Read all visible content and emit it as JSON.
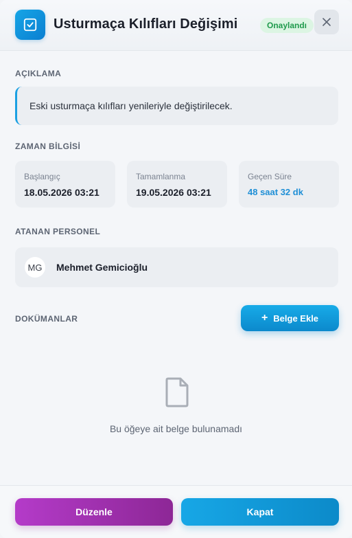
{
  "header": {
    "title": "Usturmaça Kılıfları Değişimi",
    "status": "Onaylandı",
    "app_icon": "checkbox-edit-icon",
    "close_icon": "close-icon"
  },
  "description": {
    "label": "AÇIKLAMA",
    "text": "Eski usturmaça kılıfları yenileriyle değiştirilecek."
  },
  "time": {
    "label": "ZAMAN BİLGİSİ",
    "start": {
      "label": "Başlangıç",
      "value": "18.05.2026 03:21"
    },
    "end": {
      "label": "Tamamlanma",
      "value": "19.05.2026 03:21"
    },
    "elapsed": {
      "label": "Geçen Süre",
      "value": "48 saat 32 dk"
    }
  },
  "personnel": {
    "label": "ATANAN PERSONEL",
    "initials": "MG",
    "name": "Mehmet Gemicioğlu"
  },
  "documents": {
    "label": "DOKÜMANLAR",
    "add_button": "Belge Ekle",
    "empty_text": "Bu öğeye ait belge bulunamadı",
    "empty_icon": "document-icon"
  },
  "footer": {
    "edit_button": "Düzenle",
    "close_button": "Kapat"
  },
  "colors": {
    "accent": "#1aa0e2",
    "status_bg": "#dcf5e3",
    "status_text": "#1f9a4c",
    "edit_button": "#a533b9",
    "close_button": "#129ad9"
  }
}
